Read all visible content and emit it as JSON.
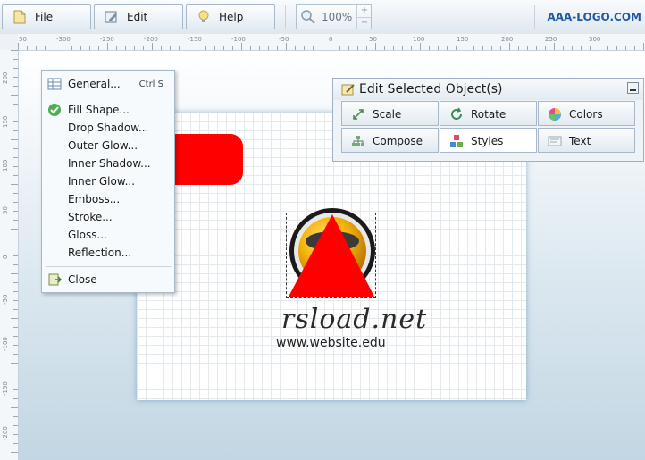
{
  "toolbar": {
    "file_label": "File",
    "edit_label": "Edit",
    "help_label": "Help",
    "zoom_value": "100%",
    "zoom_up": "+",
    "zoom_down": "−",
    "brand": "AAA-LOGO.COM"
  },
  "ruler": {
    "top_ticks": [
      "50",
      "-300",
      "-250",
      "-200",
      "-150",
      "-100",
      "-50",
      "0",
      "50",
      "100",
      "150",
      "200",
      "250",
      "300"
    ],
    "left_ticks": [
      "200",
      "150",
      "100",
      "50",
      "0",
      "-50",
      "-100",
      "-150",
      "-200"
    ]
  },
  "menu": {
    "items": [
      {
        "label": "General...",
        "shortcut": "Ctrl S",
        "icon": "table-icon"
      },
      {
        "label": "Fill Shape...",
        "icon": "check-icon"
      },
      {
        "label": "Drop Shadow..."
      },
      {
        "label": "Outer Glow..."
      },
      {
        "label": "Inner Shadow..."
      },
      {
        "label": "Inner Glow..."
      },
      {
        "label": "Emboss..."
      },
      {
        "label": "Stroke..."
      },
      {
        "label": "Gloss..."
      },
      {
        "label": "Reflection..."
      },
      {
        "label": "Close",
        "icon": "close-doc-icon"
      }
    ]
  },
  "panel": {
    "title": "Edit Selected Object(s)",
    "buttons": [
      {
        "label": "Scale"
      },
      {
        "label": "Rotate"
      },
      {
        "label": "Colors"
      },
      {
        "label": "Compose"
      },
      {
        "label": "Styles"
      },
      {
        "label": "Text"
      }
    ]
  },
  "canvas": {
    "logo_text": "rsload.net",
    "logo_sub": "www.website.edu"
  },
  "colors": {
    "accent": "#1f5aa0",
    "shape_red": "#ff0000"
  }
}
